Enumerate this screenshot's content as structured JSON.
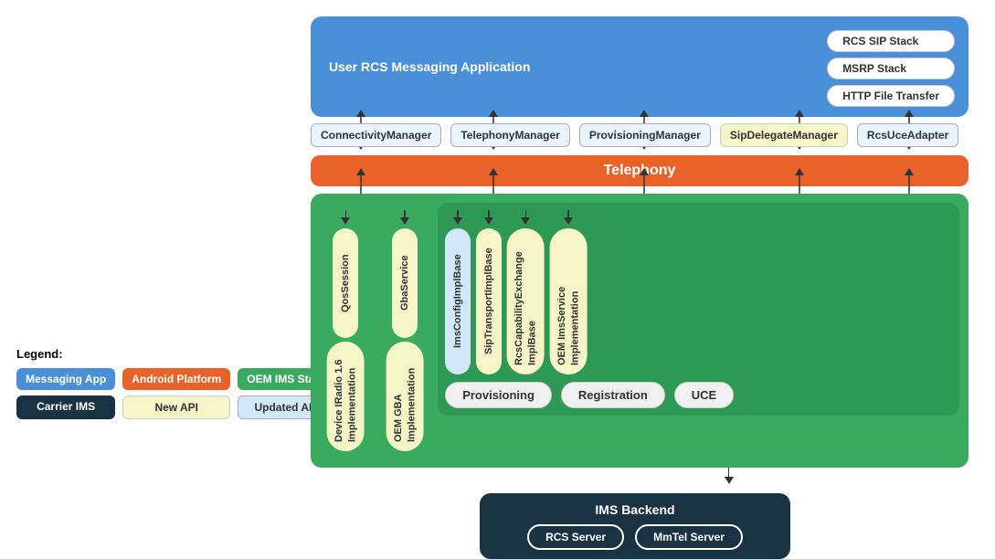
{
  "legend": {
    "title": "Legend:",
    "items": [
      {
        "label": "Messaging App",
        "type": "blue"
      },
      {
        "label": "Android Platform",
        "type": "orange"
      },
      {
        "label": "OEM IMS Stack",
        "type": "green"
      },
      {
        "label": "Carrier IMS",
        "type": "dark"
      },
      {
        "label": "New API",
        "type": "cream"
      },
      {
        "label": "Updated API",
        "type": "light-blue"
      }
    ]
  },
  "user_rcs_box": {
    "label": "User RCS Messaging Application",
    "stacks": [
      "RCS SIP Stack",
      "MSRP Stack",
      "HTTP File Transfer"
    ]
  },
  "managers": [
    {
      "label": "ConnectivityManager",
      "type": "light"
    },
    {
      "label": "TelephonyManager",
      "type": "light"
    },
    {
      "label": "ProvisioningManager",
      "type": "light"
    },
    {
      "label": "SipDelegateManager",
      "type": "cream"
    },
    {
      "label": "RcsUceAdapter",
      "type": "light"
    }
  ],
  "telephony": {
    "label": "Telephony"
  },
  "oem_ims": {
    "left_section": {
      "pill1": {
        "label": "QosSession"
      },
      "pill2": {
        "label": "Device IRadio 1.6 Implementation"
      }
    },
    "mid_section": {
      "pill1": {
        "label": "GbaService"
      },
      "pill2": {
        "label": "OEM GBA Implementation"
      }
    },
    "right_section": {
      "pills": [
        {
          "label": "ImsConfigImplBase",
          "type": "light-blue"
        },
        {
          "label": "SipTransportImplBase",
          "type": "cream"
        },
        {
          "label": "RcsCapabilityExchange ImplBase",
          "type": "cream"
        },
        {
          "label": "OEM ImsService Implementation",
          "type": "cream"
        }
      ],
      "sub_labels": [
        "Provisioning",
        "Registration",
        "UCE"
      ]
    }
  },
  "ims_backend": {
    "title": "IMS Backend",
    "servers": [
      "RCS Server",
      "MmTel Server"
    ]
  }
}
